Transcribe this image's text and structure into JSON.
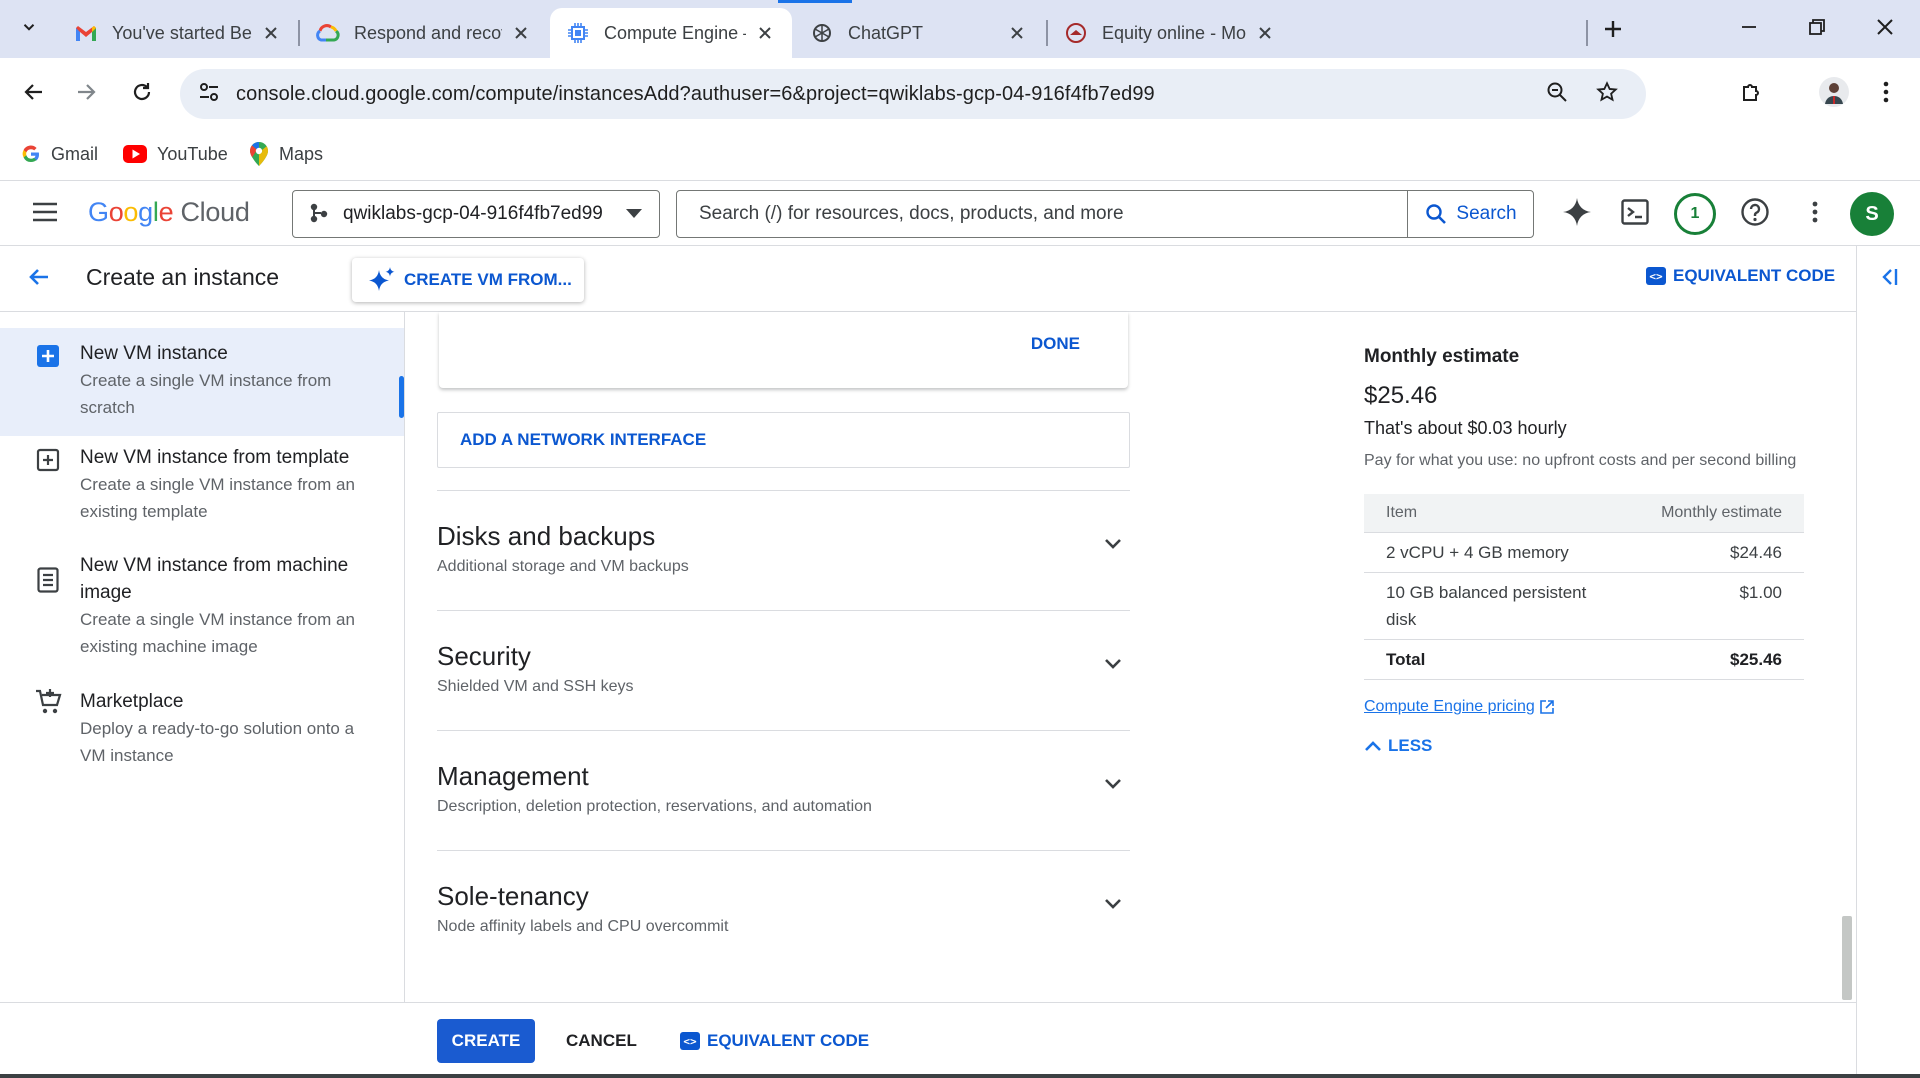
{
  "browser": {
    "tabs": [
      {
        "title": "You've started Beginner: C",
        "icon": "gmail-icon"
      },
      {
        "title": "Respond and recover fro",
        "icon": "google-cloud-icon"
      },
      {
        "title": "Compute Engine – qwikla",
        "icon": "compute-engine-icon",
        "active": true
      },
      {
        "title": "ChatGPT",
        "icon": "chatgpt-icon"
      },
      {
        "title": "Equity online - More thar",
        "icon": "equity-icon"
      }
    ],
    "url": "console.cloud.google.com/compute/instancesAdd?authuser=6&project=qwiklabs-gcp-04-916f4fb7ed99",
    "bookmarks": [
      {
        "label": "Gmail",
        "icon": "google-icon"
      },
      {
        "label": "YouTube",
        "icon": "youtube-icon"
      },
      {
        "label": "Maps",
        "icon": "maps-icon"
      }
    ]
  },
  "header": {
    "logo_google": "Google",
    "logo_cloud": "Cloud",
    "project": "qwiklabs-gcp-04-916f4fb7ed99",
    "search_placeholder": "Search (/) for resources, docs, products, and more",
    "search_button": "Search",
    "notification_count": "1",
    "avatar_letter": "S"
  },
  "page": {
    "title": "Create an instance",
    "create_vm_from": "CREATE VM FROM...",
    "equivalent_code": "EQUIVALENT CODE"
  },
  "leftnav": {
    "items": [
      {
        "title": "New VM instance",
        "desc": "Create a single VM instance from scratch"
      },
      {
        "title": "New VM instance from template",
        "desc": "Create a single VM instance from an existing template"
      },
      {
        "title": "New VM instance from machine image",
        "desc": "Create a single VM instance from an existing machine image"
      },
      {
        "title": "Marketplace",
        "desc": "Deploy a ready-to-go solution onto a VM instance"
      }
    ]
  },
  "main": {
    "done_label": "DONE",
    "add_network_interface": "ADD A NETWORK INTERFACE",
    "sections": [
      {
        "title": "Disks and backups",
        "desc": "Additional storage and VM backups"
      },
      {
        "title": "Security",
        "desc": "Shielded VM and SSH keys"
      },
      {
        "title": "Management",
        "desc": "Description, deletion protection, reservations, and automation"
      },
      {
        "title": "Sole-tenancy",
        "desc": "Node affinity labels and CPU overcommit"
      }
    ]
  },
  "pricing": {
    "label": "Monthly estimate",
    "total": "$25.46",
    "hourly": "That's about $0.03 hourly",
    "billing_note": "Pay for what you use: no upfront costs and per second billing",
    "table_headers": [
      "Item",
      "Monthly estimate"
    ],
    "rows": [
      {
        "item": "2 vCPU + 4 GB memory",
        "cost": "$24.46"
      },
      {
        "item": "10 GB balanced persistent disk",
        "cost": "$1.00"
      }
    ],
    "total_row": {
      "item": "Total",
      "cost": "$25.46"
    },
    "pricing_link": "Compute Engine pricing",
    "less_label": "LESS"
  },
  "footer": {
    "create": "CREATE",
    "cancel": "CANCEL",
    "equivalent_code": "EQUIVALENT CODE"
  },
  "colors": {
    "accent": "#0b57d0",
    "primary_button": "#1a5bd0",
    "active_nav_bg": "#e8eefa",
    "tabbar_bg": "#dde3f3"
  }
}
